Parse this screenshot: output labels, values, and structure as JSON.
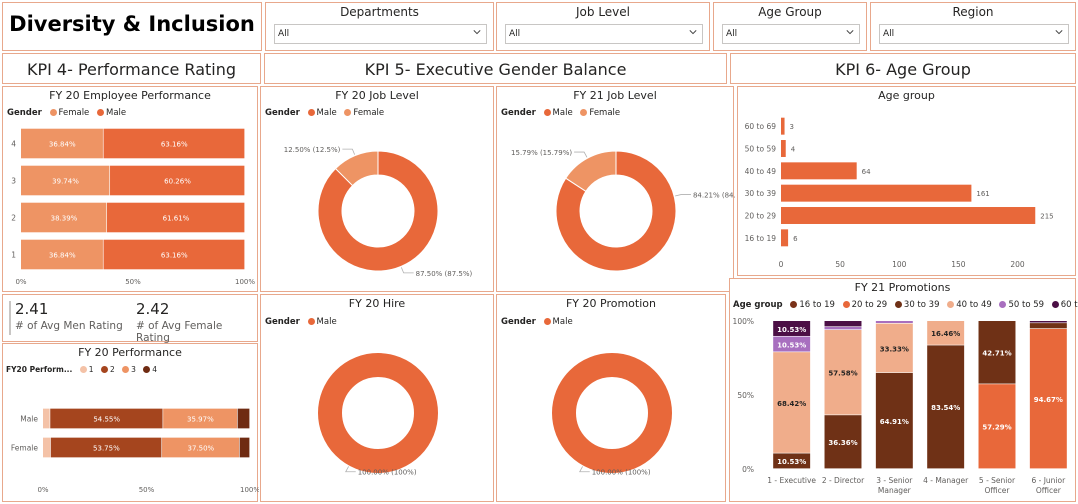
{
  "header": {
    "title": "Diversity & Inclusion"
  },
  "slicers": [
    {
      "label": "Departments",
      "value": "All"
    },
    {
      "label": "Job Level",
      "value": "All"
    },
    {
      "label": "Age Group",
      "value": "All"
    },
    {
      "label": "Region",
      "value": "All"
    }
  ],
  "kpis": {
    "kpi4": "KPI 4- Performance Rating",
    "kpi5": "KPI 5- Executive Gender Balance",
    "kpi6": "KPI 6- Age Group"
  },
  "colors": {
    "male": "#e8683a",
    "female": "#ee9464",
    "age_16_19": "#7a3219",
    "age_20_29": "#e8683a",
    "age_30_39": "#6f3116",
    "age_40_49": "#f0ad8b",
    "age_50_59": "#a86fbf",
    "age_60_69": "#4b0f45",
    "perf_1": "#f4c2a7",
    "perf_2": "#a5451e",
    "perf_3": "#ee9464",
    "perf_4": "#6f2b12",
    "border": "#e8a88c"
  },
  "legend_labels": {
    "gender": "Gender",
    "male": "Male",
    "female": "Female",
    "age_group": "Age group",
    "fy20_perf": "FY20 Perform...",
    "p1": "1",
    "p2": "2",
    "p3": "3",
    "p4": "4"
  },
  "cards": {
    "men_value": "2.41",
    "men_label": "# of Avg Men Rating",
    "women_value": "2.42",
    "women_label": "# of Avg Female Rating"
  },
  "chart_data": [
    {
      "id": "fy20_employee_performance",
      "type": "bar",
      "stacked": "100%",
      "orientation": "horizontal",
      "title": "FY 20 Employee Performance",
      "categories": [
        "4",
        "3",
        "2",
        "1"
      ],
      "series": [
        {
          "name": "Female",
          "values": [
            36.84,
            39.74,
            38.39,
            36.84
          ],
          "labels": [
            "36.84%",
            "39.74%",
            "38.39%",
            "36.84%"
          ]
        },
        {
          "name": "Male",
          "values": [
            63.16,
            60.26,
            61.61,
            63.16
          ],
          "labels": [
            "63.16%",
            "60.26%",
            "61.61%",
            "63.16%"
          ]
        }
      ],
      "x_ticks": [
        "0%",
        "50%",
        "100%"
      ]
    },
    {
      "id": "fy20_job_level",
      "type": "pie",
      "donut": true,
      "title": "FY 20 Job Level",
      "slices": [
        {
          "name": "Male",
          "value": 87.5,
          "label": "87.50% (87.5%)"
        },
        {
          "name": "Female",
          "value": 12.5,
          "label": "12.50% (12.5%)"
        }
      ]
    },
    {
      "id": "fy21_job_level",
      "type": "pie",
      "donut": true,
      "title": "FY 21 Job Level",
      "slices": [
        {
          "name": "Male",
          "value": 84.21,
          "label": "84.21% (84.21%)"
        },
        {
          "name": "Female",
          "value": 15.79,
          "label": "15.79% (15.79%)"
        }
      ]
    },
    {
      "id": "age_group",
      "type": "bar",
      "orientation": "horizontal",
      "title": "Age group",
      "categories": [
        "60 to 69",
        "50 to 59",
        "40 to 49",
        "30 to 39",
        "20 to 29",
        "16 to 19"
      ],
      "values": [
        3,
        4,
        64,
        161,
        215,
        6
      ],
      "xlim": [
        0,
        230
      ],
      "x_ticks": [
        "0",
        "50",
        "100",
        "150",
        "200"
      ]
    },
    {
      "id": "fy20_hire",
      "type": "pie",
      "donut": true,
      "title": "FY 20 Hire",
      "slices": [
        {
          "name": "Male",
          "value": 100,
          "label": "100.00% (100%)"
        }
      ]
    },
    {
      "id": "fy20_promotion",
      "type": "pie",
      "donut": true,
      "title": "FY 20 Promotion",
      "slices": [
        {
          "name": "Male",
          "value": 100,
          "label": "100.00% (100%)"
        }
      ]
    },
    {
      "id": "fy20_performance",
      "type": "bar",
      "stacked": "100%",
      "orientation": "horizontal",
      "title": "FY 20 Performance",
      "categories": [
        "Male",
        "Female"
      ],
      "series": [
        {
          "name": "1",
          "values": [
            3.5,
            3.75
          ],
          "labels": [
            "",
            ""
          ]
        },
        {
          "name": "2",
          "values": [
            54.55,
            53.75
          ],
          "labels": [
            "54.55%",
            "53.75%"
          ]
        },
        {
          "name": "3",
          "values": [
            35.97,
            37.5
          ],
          "labels": [
            "35.97%",
            "37.50%"
          ]
        },
        {
          "name": "4",
          "values": [
            5.98,
            5.0
          ],
          "labels": [
            "",
            ""
          ]
        }
      ],
      "x_ticks": [
        "0%",
        "50%",
        "100%"
      ]
    },
    {
      "id": "fy21_promotions",
      "type": "bar",
      "stacked": "100%",
      "orientation": "vertical",
      "title": "FY 21 Promotions",
      "categories": [
        "1 - Executive",
        "2 - Director",
        "3 - Senior Manager",
        "4 - Manager",
        "5 - Senior Officer",
        "6 - Junior Officer"
      ],
      "series": [
        {
          "name": "16 to 19",
          "values": [
            0,
            0,
            0,
            0,
            0,
            0
          ],
          "labels": [
            "",
            "",
            "",
            "",
            "",
            ""
          ]
        },
        {
          "name": "20 to 29",
          "values": [
            0,
            0,
            0,
            0,
            57.29,
            94.67
          ],
          "labels": [
            "",
            "",
            "",
            "",
            "57.29%",
            "94.67%"
          ]
        },
        {
          "name": "30 to 39",
          "values": [
            10.53,
            36.36,
            64.91,
            83.54,
            42.71,
            3.9
          ],
          "labels": [
            "10.53%",
            "36.36%",
            "64.91%",
            "83.54%",
            "42.71%",
            ""
          ]
        },
        {
          "name": "40 to 49",
          "values": [
            68.42,
            57.58,
            33.33,
            16.46,
            0,
            0
          ],
          "labels": [
            "68.42%",
            "57.58%",
            "33.33%",
            "16.46%",
            "",
            ""
          ]
        },
        {
          "name": "50 to 59",
          "values": [
            10.53,
            2.0,
            1.76,
            0,
            0,
            0
          ],
          "labels": [
            "10.53%",
            "",
            "",
            "",
            "",
            ""
          ]
        },
        {
          "name": "60 to 69",
          "values": [
            10.53,
            4.06,
            0,
            0,
            0,
            1.43
          ],
          "labels": [
            "10.53%",
            "",
            "",
            "",
            "",
            ""
          ]
        }
      ],
      "y_ticks": [
        "100%",
        "50%",
        "0%"
      ]
    }
  ]
}
